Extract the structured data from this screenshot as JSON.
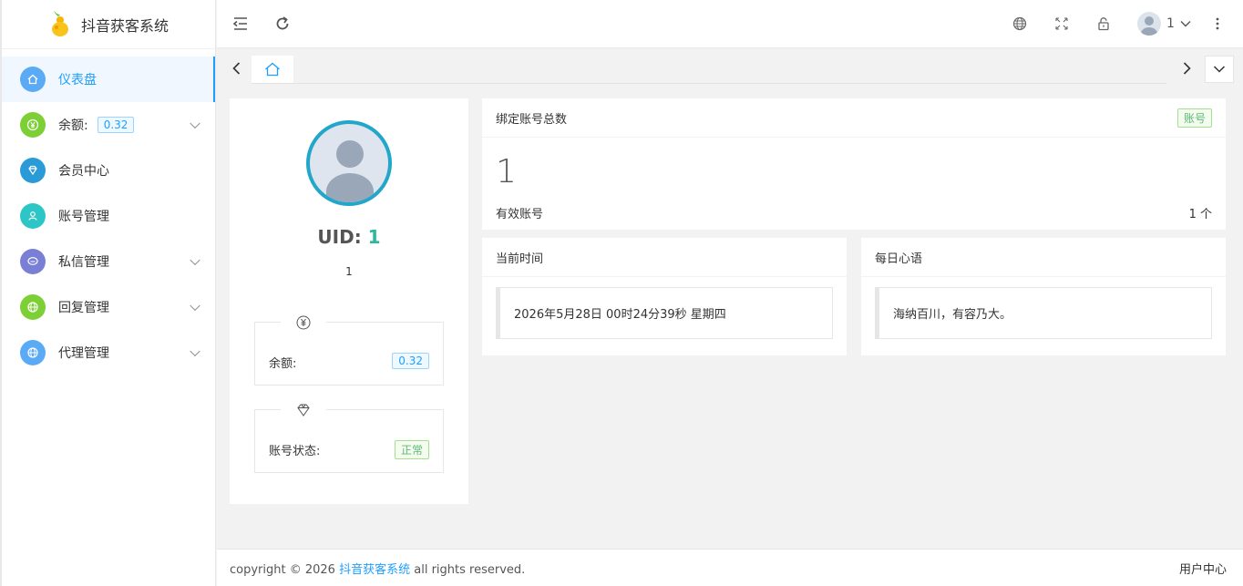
{
  "app": {
    "title": "抖音获客系统"
  },
  "sidebar": {
    "items": [
      {
        "label": "仪表盘",
        "icon": "home-icon",
        "color": "#5aaaf5",
        "active": true
      },
      {
        "label": "余额:",
        "badge": "0.32",
        "icon": "yen-icon",
        "color": "#7ccf35",
        "has_submenu": true
      },
      {
        "label": "会员中心",
        "icon": "diamond-icon",
        "color": "#2a9bd6"
      },
      {
        "label": "账号管理",
        "icon": "user-icon",
        "color": "#2cc6c6"
      },
      {
        "label": "私信管理",
        "icon": "chat-icon",
        "color": "#7a7fd6",
        "has_submenu": true
      },
      {
        "label": "回复管理",
        "icon": "globe-icon",
        "color": "#7ccf35",
        "has_submenu": true
      },
      {
        "label": "代理管理",
        "icon": "globe-icon",
        "color": "#5aaaf5",
        "has_submenu": true
      }
    ]
  },
  "header": {
    "username": "1"
  },
  "profile": {
    "uid_label": "UID:",
    "uid": "1",
    "name": "1",
    "balance_label": "余额:",
    "balance": "0.32",
    "status_label": "账号状态:",
    "status": "正常"
  },
  "accounts_card": {
    "title": "绑定账号总数",
    "tag": "账号",
    "total": "1",
    "valid_label": "有效账号",
    "valid_value": "1 个"
  },
  "time_card": {
    "title": "当前时间",
    "value": "2026年5月28日 00时24分39秒 星期四"
  },
  "quote_card": {
    "title": "每日心语",
    "value": "海纳百川，有容乃大。"
  },
  "footer": {
    "copyright": "copyright © 2026",
    "brand": "抖音获客系统",
    "rights": "all rights reserved.",
    "right_link": "用户中心"
  }
}
